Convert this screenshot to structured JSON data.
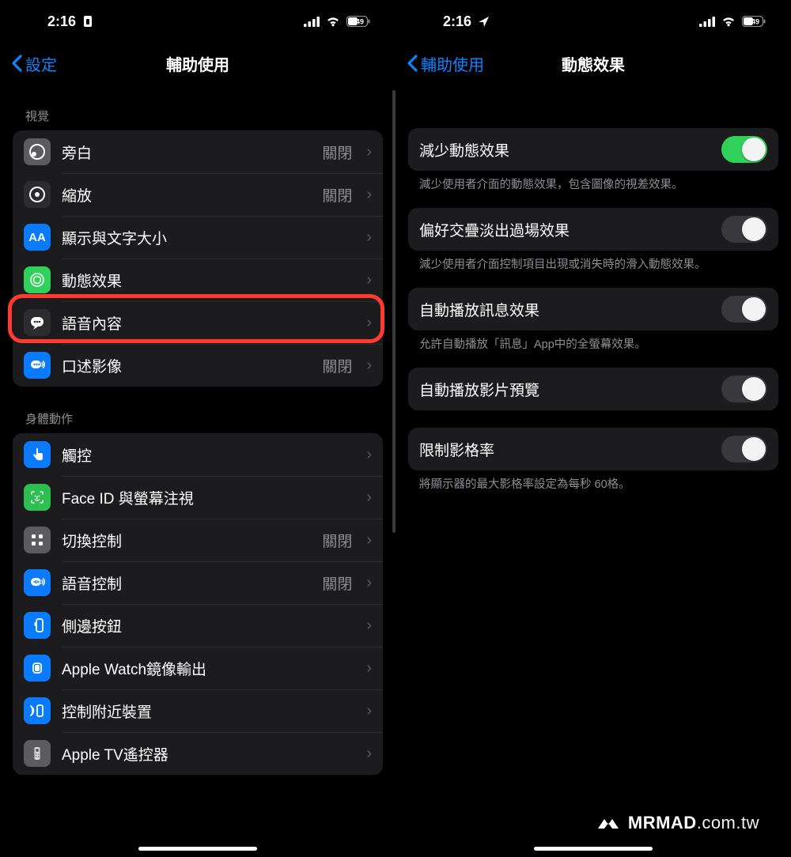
{
  "status": {
    "time": "2:16",
    "battery": "49"
  },
  "left": {
    "back": "設定",
    "title": "輔助使用",
    "section_visual": "視覺",
    "section_physical": "身體動作",
    "off": "關閉",
    "rows_visual": [
      {
        "label": "旁白",
        "value": "關閉",
        "icon": "voiceover"
      },
      {
        "label": "縮放",
        "value": "關閉",
        "icon": "zoom"
      },
      {
        "label": "顯示與文字大小",
        "value": "",
        "icon": "display-text"
      },
      {
        "label": "動態效果",
        "value": "",
        "icon": "motion"
      },
      {
        "label": "語音內容",
        "value": "",
        "icon": "spoken"
      },
      {
        "label": "口述影像",
        "value": "關閉",
        "icon": "audio-desc"
      }
    ],
    "rows_physical": [
      {
        "label": "觸控",
        "value": "",
        "icon": "touch"
      },
      {
        "label": "Face ID 與螢幕注視",
        "value": "",
        "icon": "faceid"
      },
      {
        "label": "切換控制",
        "value": "關閉",
        "icon": "switch-control"
      },
      {
        "label": "語音控制",
        "value": "關閉",
        "icon": "voice-control"
      },
      {
        "label": "側邊按鈕",
        "value": "",
        "icon": "side-button"
      },
      {
        "label": "Apple Watch鏡像輸出",
        "value": "",
        "icon": "watch-mirror"
      },
      {
        "label": "控制附近裝置",
        "value": "",
        "icon": "nearby"
      },
      {
        "label": "Apple TV遙控器",
        "value": "",
        "icon": "appletv-remote"
      }
    ]
  },
  "right": {
    "back": "輔助使用",
    "title": "動態效果",
    "rows": [
      {
        "label": "減少動態效果",
        "on": true,
        "note": "減少使用者介面的動態效果，包含圖像的視差效果。"
      },
      {
        "label": "偏好交疊淡出過場效果",
        "on": false,
        "note": "減少使用者介面控制項目出現或消失時的滑入動態效果。"
      },
      {
        "label": "自動播放訊息效果",
        "on": false,
        "note": "允許自動播放「訊息」App中的全螢幕效果。"
      },
      {
        "label": "自動播放影片預覽",
        "on": false,
        "note": ""
      },
      {
        "label": "限制影格率",
        "on": false,
        "note": "將顯示器的最大影格率設定為每秒 60格。"
      }
    ]
  },
  "watermark": {
    "brand": "MRMAD",
    "suffix": ".com.tw"
  }
}
